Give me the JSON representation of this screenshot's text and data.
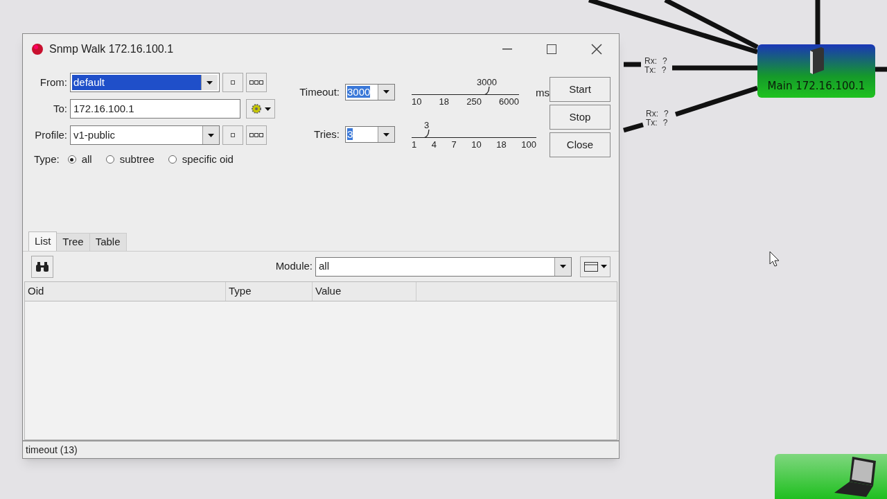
{
  "window": {
    "title": "Snmp Walk 172.16.100.1"
  },
  "form": {
    "from": {
      "label": "From:",
      "value": "default"
    },
    "to": {
      "label": "To:",
      "value": "172.16.100.1"
    },
    "profile": {
      "label": "Profile:",
      "value": "v1-public"
    },
    "type": {
      "label": "Type:",
      "options": [
        {
          "label": "all",
          "selected": true
        },
        {
          "label": "subtree",
          "selected": false
        },
        {
          "label": "specific oid",
          "selected": false
        }
      ]
    }
  },
  "sliders": [
    {
      "label": "Timeout:",
      "value": "3000",
      "reading": "3000",
      "unit": "ms",
      "level": 0.7,
      "ticks": [
        "10",
        "18",
        "250",
        "6000"
      ]
    },
    {
      "label": "Tries:",
      "value": "3",
      "reading": "3",
      "level": 0.12,
      "ticks": [
        "1",
        "4",
        "7",
        "10",
        "18",
        "100"
      ]
    }
  ],
  "buttons": [
    "Start",
    "Stop",
    "Close"
  ],
  "tabs": [
    {
      "label": "List",
      "selected": true
    },
    {
      "label": "Tree",
      "selected": false
    },
    {
      "label": "Table",
      "selected": false
    }
  ],
  "module": {
    "label": "Module:",
    "value": "all"
  },
  "table": {
    "columns": [
      "Oid",
      "Type",
      "Value"
    ]
  },
  "status_bar": "timeout (13)",
  "map": {
    "nodes": [
      {
        "kind": "router",
        "label": "Main 172.16.100.1"
      },
      {
        "kind": "laptop"
      }
    ],
    "links": [
      {
        "rx_label": "Rx:",
        "rx": "?",
        "tx_label": "Tx:",
        "tx": "?"
      },
      {
        "rx_label": "Rx:",
        "rx": "?",
        "tx_label": "Tx:",
        "tx": "?"
      }
    ]
  }
}
